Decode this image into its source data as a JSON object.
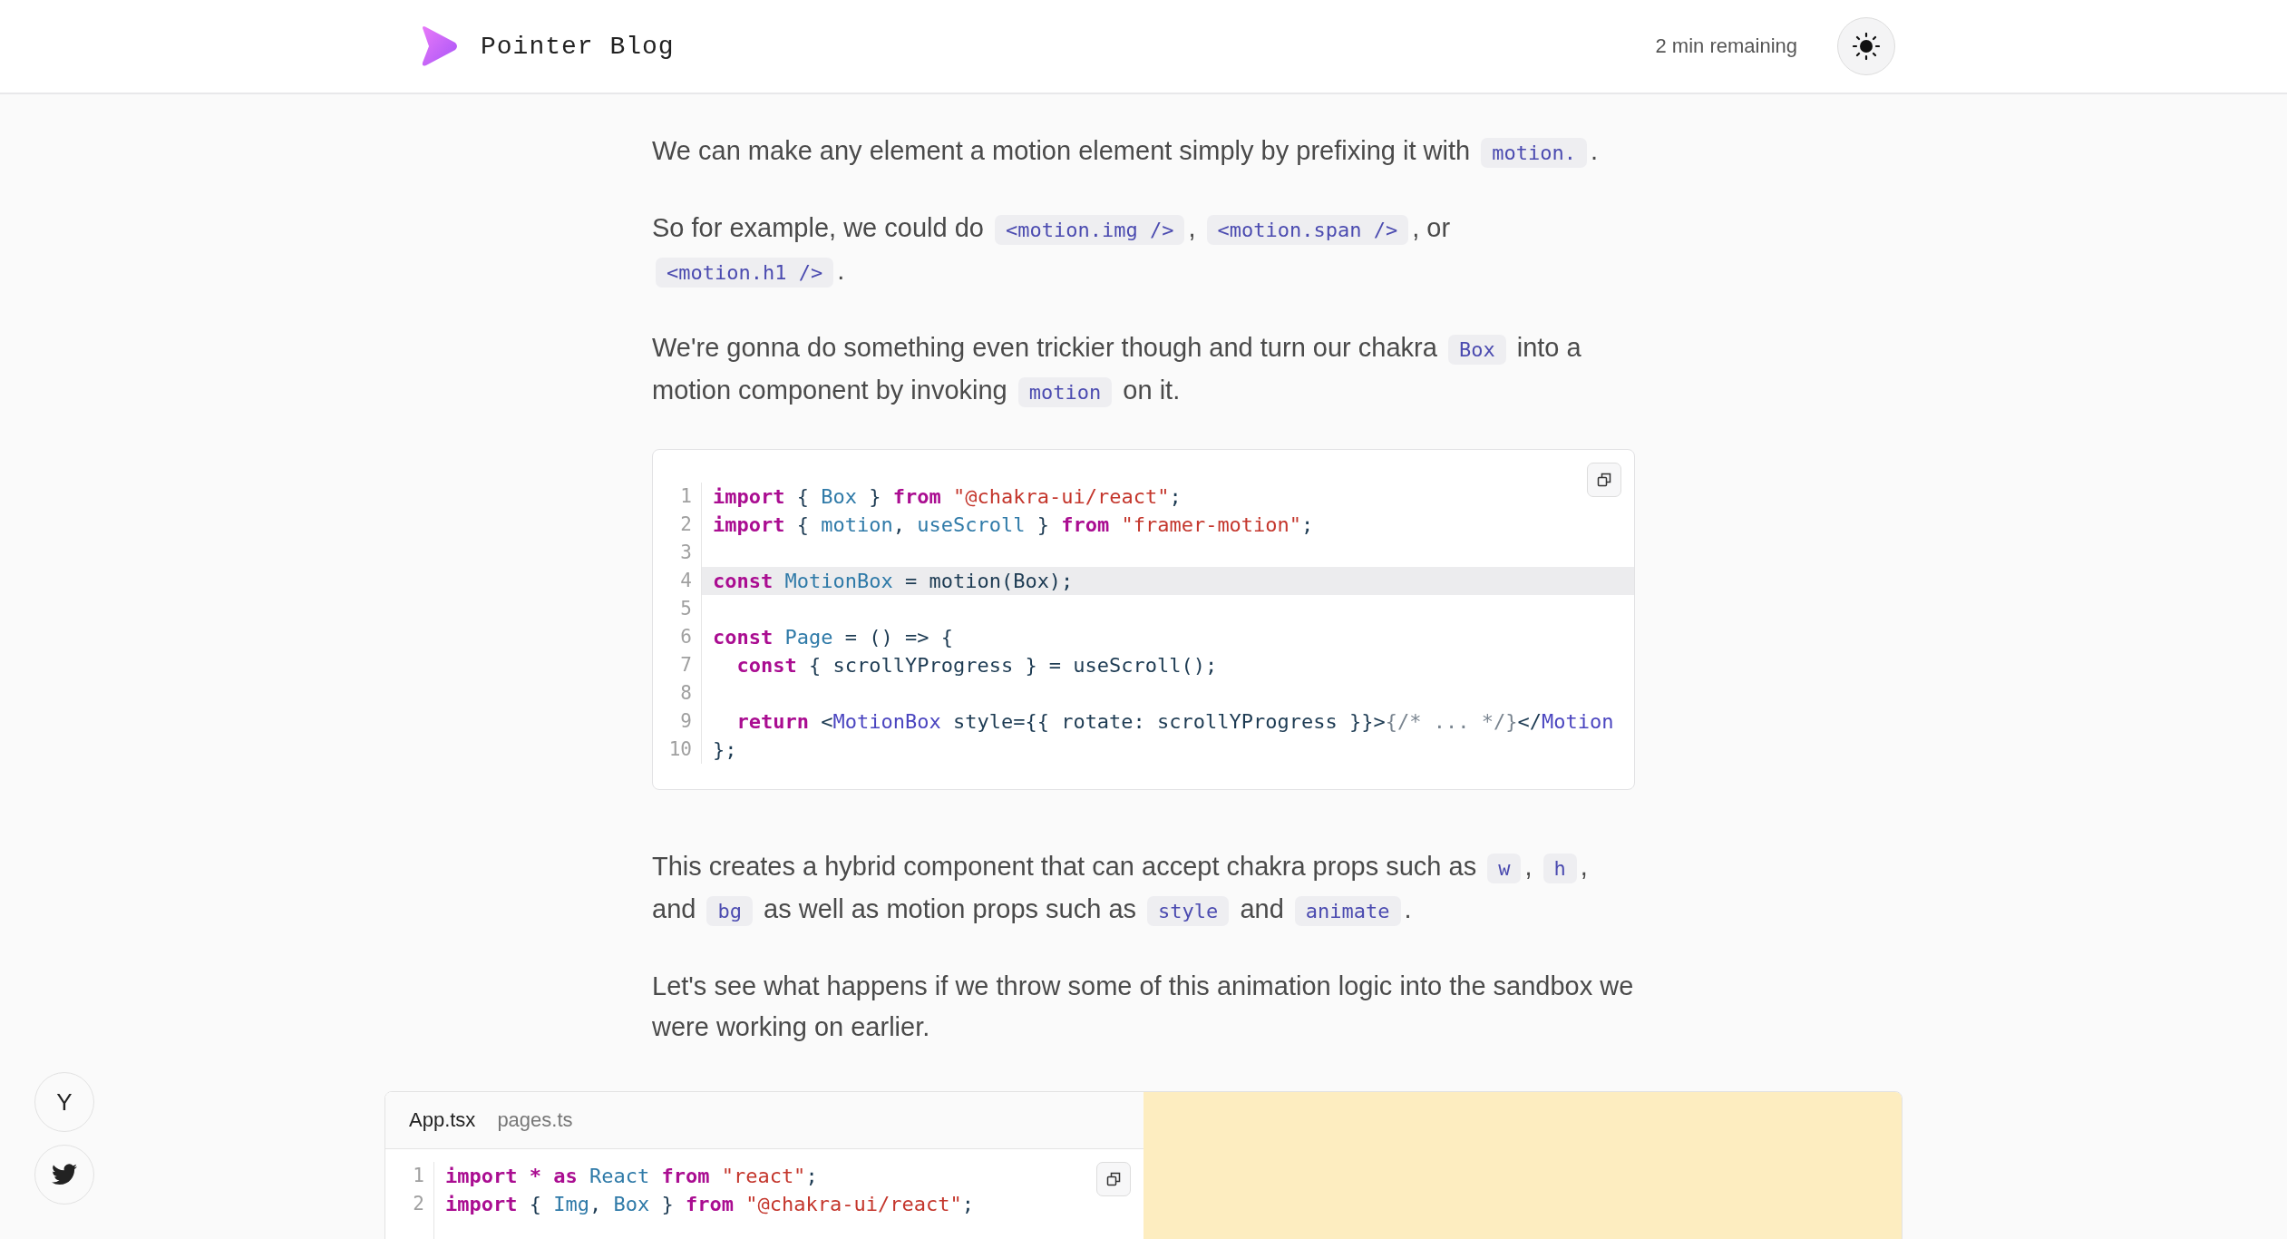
{
  "header": {
    "title": "Pointer Blog",
    "reading_time": "2 min remaining"
  },
  "paragraphs_top": [
    [
      {
        "kind": "text",
        "text": "We can make any element a motion element simply by prefixing it with "
      },
      {
        "kind": "code",
        "text": "motion."
      },
      {
        "kind": "text",
        "text": "."
      }
    ],
    [
      {
        "kind": "text",
        "text": "So for example, we could do "
      },
      {
        "kind": "code",
        "text": "<motion.img />"
      },
      {
        "kind": "text",
        "text": ", "
      },
      {
        "kind": "code",
        "text": "<motion.span />"
      },
      {
        "kind": "text",
        "text": ", or "
      },
      {
        "kind": "code",
        "text": "<motion.h1 />"
      },
      {
        "kind": "text",
        "text": "."
      }
    ],
    [
      {
        "kind": "text",
        "text": "We're gonna do something even trickier though and turn our chakra "
      },
      {
        "kind": "code",
        "text": "Box"
      },
      {
        "kind": "text",
        "text": " into a motion component by invoking "
      },
      {
        "kind": "code",
        "text": "motion"
      },
      {
        "kind": "text",
        "text": " on it."
      }
    ]
  ],
  "code_block": {
    "lines": [
      {
        "number": "1",
        "highlighted": false,
        "tokens": [
          {
            "kind": "keyword",
            "text": "import"
          },
          {
            "kind": "plain",
            "text": " { "
          },
          {
            "kind": "name",
            "text": "Box"
          },
          {
            "kind": "plain",
            "text": " } "
          },
          {
            "kind": "keyword",
            "text": "from"
          },
          {
            "kind": "string",
            "text": " \"@chakra-ui/react\""
          },
          {
            "kind": "plain",
            "text": ";"
          }
        ]
      },
      {
        "number": "2",
        "highlighted": false,
        "tokens": [
          {
            "kind": "keyword",
            "text": "import"
          },
          {
            "kind": "plain",
            "text": " { "
          },
          {
            "kind": "name",
            "text": "motion"
          },
          {
            "kind": "plain",
            "text": ", "
          },
          {
            "kind": "name",
            "text": "useScroll"
          },
          {
            "kind": "plain",
            "text": " } "
          },
          {
            "kind": "keyword",
            "text": "from"
          },
          {
            "kind": "string",
            "text": " \"framer-motion\""
          },
          {
            "kind": "plain",
            "text": ";"
          }
        ]
      },
      {
        "number": "3",
        "highlighted": false
      },
      {
        "number": "4",
        "highlighted": true,
        "tokens": [
          {
            "kind": "keyword",
            "text": "const"
          },
          {
            "kind": "name",
            "text": " MotionBox"
          },
          {
            "kind": "plain",
            "text": " = motion(Box);"
          }
        ]
      },
      {
        "number": "5",
        "highlighted": false
      },
      {
        "number": "6",
        "highlighted": false,
        "tokens": [
          {
            "kind": "keyword",
            "text": "const"
          },
          {
            "kind": "name",
            "text": " Page"
          },
          {
            "kind": "plain",
            "text": " = () => {"
          }
        ]
      },
      {
        "number": "7",
        "highlighted": false,
        "tokens": [
          {
            "kind": "keyword",
            "text": "  const"
          },
          {
            "kind": "plain",
            "text": " { scrollYProgress } = useScroll();"
          }
        ]
      },
      {
        "number": "8",
        "highlighted": false
      },
      {
        "number": "9",
        "highlighted": false,
        "tokens": [
          {
            "kind": "keyword",
            "text": "  return"
          },
          {
            "kind": "plain",
            "text": " <"
          },
          {
            "kind": "tag",
            "text": "MotionBox"
          },
          {
            "kind": "plain",
            "text": " style={{ rotate: scrollYProgress }}>"
          },
          {
            "kind": "comment",
            "text": "{/* ... */}"
          },
          {
            "kind": "plain",
            "text": "</"
          },
          {
            "kind": "tag",
            "text": "Motion"
          }
        ]
      },
      {
        "number": "10",
        "highlighted": false,
        "tokens": [
          {
            "kind": "plain",
            "text": "};"
          }
        ]
      }
    ]
  },
  "paragraphs_bottom": [
    [
      {
        "kind": "text",
        "text": "This creates a hybrid component that can accept chakra props such as "
      },
      {
        "kind": "code",
        "text": "w"
      },
      {
        "kind": "text",
        "text": ", "
      },
      {
        "kind": "code",
        "text": "h"
      },
      {
        "kind": "text",
        "text": ", and "
      },
      {
        "kind": "code",
        "text": "bg"
      },
      {
        "kind": "text",
        "text": " as well as motion props such as "
      },
      {
        "kind": "code",
        "text": "style"
      },
      {
        "kind": "text",
        "text": " and "
      },
      {
        "kind": "code",
        "text": "animate"
      },
      {
        "kind": "text",
        "text": "."
      }
    ],
    [
      {
        "kind": "text",
        "text": "Let's see what happens if we throw some of this animation logic into the sandbox we were working on earlier."
      }
    ]
  ],
  "share_buttons": [
    {
      "kind": "letter",
      "text": "Y"
    },
    {
      "kind": "twitter"
    }
  ],
  "sandbox": {
    "tabs": [
      {
        "label": "App.tsx",
        "selected": true
      },
      {
        "label": "pages.ts",
        "selected": false
      }
    ],
    "lines": [
      {
        "number": "1",
        "highlighted": false,
        "tokens": [
          {
            "kind": "keyword",
            "text": "import * as"
          },
          {
            "kind": "name",
            "text": " React "
          },
          {
            "kind": "keyword",
            "text": "from"
          },
          {
            "kind": "string",
            "text": " \"react\""
          },
          {
            "kind": "plain",
            "text": ";"
          }
        ]
      },
      {
        "number": "2",
        "highlighted": false,
        "tokens": [
          {
            "kind": "keyword",
            "text": "import"
          },
          {
            "kind": "plain",
            "text": " { "
          },
          {
            "kind": "name",
            "text": "Img"
          },
          {
            "kind": "plain",
            "text": ", "
          },
          {
            "kind": "name",
            "text": "Box"
          },
          {
            "kind": "plain",
            "text": " } "
          },
          {
            "kind": "keyword",
            "text": "from"
          },
          {
            "kind": "string",
            "text": " \"@chakra-ui/react\""
          },
          {
            "kind": "plain",
            "text": ";"
          }
        ]
      }
    ]
  }
}
